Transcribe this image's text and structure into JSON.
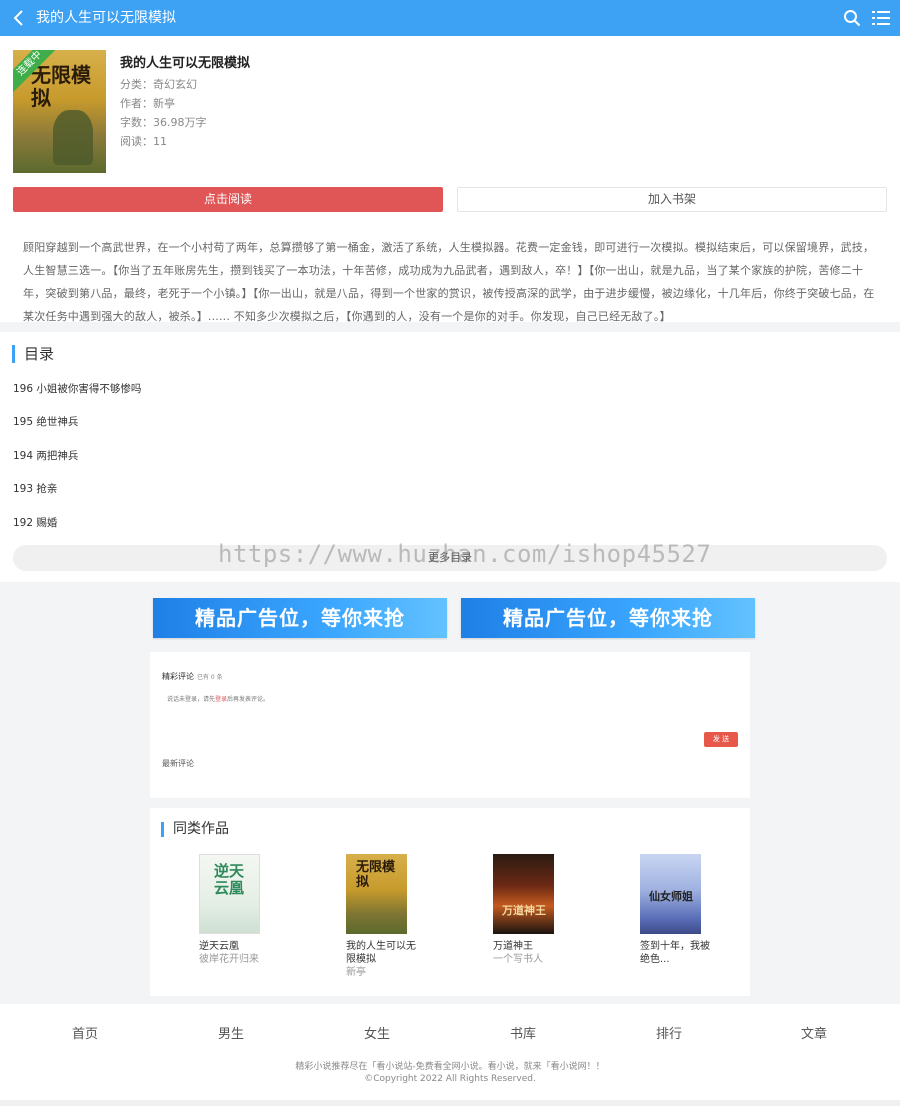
{
  "header": {
    "title": "我的人生可以无限模拟"
  },
  "book": {
    "badge": "连载中",
    "cover_title": "无限模拟",
    "title": "我的人生可以无限模拟",
    "category": "分类：奇幻玄幻",
    "author": "作者：新亭",
    "words": "字数：36.98万字",
    "reads": "阅读：11",
    "read_button": "点击阅读",
    "shelf_button": "加入书架",
    "intro": "顾阳穿越到一个高武世界，在一个小村苟了两年，总算攒够了第一桶金，激活了系统，人生模拟器。花费一定金钱，即可进行一次模拟。模拟结束后，可以保留境界，武技，人生智慧三选一。【你当了五年账房先生，攒到钱买了一本功法，十年苦修，成功成为九品武者，遇到敌人，卒！】【你一出山，就是九品，当了某个家族的护院，苦修二十年，突破到第八品，最终，老死于一个小镇。】【你一出山，就是八品，得到一个世家的赏识，被传授高深的武学，由于进步缓慢，被边缘化，十几年后，你终于突破七品，在某次任务中遇到强大的敌人，被杀。】...... 不知多少次模拟之后，【你遇到的人，没有一个是你的对手。你发现，自己已经无敌了。】"
  },
  "toc": {
    "heading": "目录",
    "items": [
      "196 小姐被你害得不够惨吗",
      "195 绝世神兵",
      "194 两把神兵",
      "193 抢亲",
      "192 赐婚"
    ],
    "more": "更多目录",
    "watermark": "https://www.huzhan.com/ishop45527"
  },
  "ads": [
    "精品广告位，等你来抢",
    "精品广告位，等你来抢"
  ],
  "comments": {
    "title": "精彩评论",
    "count": "已有 0 条",
    "hint_pre": "说话未登录，请先",
    "hint_login": "登录",
    "hint_post": "后再发表评论。",
    "send": "发 送",
    "latest": "最新评论"
  },
  "similar": {
    "heading": "同类作品",
    "items": [
      {
        "title": "逆天云凰",
        "author": "彼岸花开归来",
        "cover_text": "逆天云凰"
      },
      {
        "title": "我的人生可以无限模拟",
        "author": "新亭",
        "cover_text": "无限模拟"
      },
      {
        "title": "万道神王",
        "author": "一个写书人",
        "cover_text": "万道神王"
      },
      {
        "title": "签到十年，我被绝色...",
        "author": "",
        "cover_text": "仙女师姐"
      }
    ]
  },
  "tabbar": [
    "首页",
    "男生",
    "女生",
    "书库",
    "排行",
    "文章"
  ],
  "footer": {
    "line1": "精彩小说推荐尽在「看小说站-免费看全网小说。看小说，就来「看小说网！！",
    "line2": "©Copyright 2022 All Rights Reserved."
  },
  "colors": {
    "accent": "#3da1f4",
    "read_button": "#e05555",
    "badge": "#3fae4a"
  },
  "icons": {
    "back": "chevron-left-icon",
    "search": "search-icon",
    "menu": "list-menu-icon"
  }
}
